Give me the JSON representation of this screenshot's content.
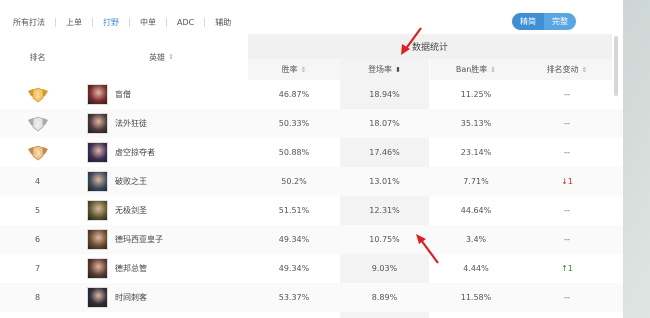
{
  "tabs": [
    {
      "label": "所有打法",
      "active": false
    },
    {
      "label": "上单",
      "active": false
    },
    {
      "label": "打野",
      "active": true
    },
    {
      "label": "中单",
      "active": false
    },
    {
      "label": "ADC",
      "active": false
    },
    {
      "label": "辅助",
      "active": false
    }
  ],
  "toggle": {
    "option_a": "精简",
    "option_b": "完整"
  },
  "headers": {
    "rank": "排名",
    "hero": "英雄",
    "group": "数据统计",
    "winrate": "胜率",
    "pickrate": "登场率",
    "banwinrate": "Ban胜率",
    "rank_change": "排名变动",
    "sort_icon": "⇕",
    "sort_active_icon": "⬍"
  },
  "rows": [
    {
      "rank": "1",
      "badge": "gold",
      "hero": "盲僧",
      "winrate": "46.87%",
      "pickrate": "18.94%",
      "banwinrate": "11.25%",
      "change": "--",
      "change_dir": "none"
    },
    {
      "rank": "2",
      "badge": "silver",
      "hero": "法外狂徒",
      "winrate": "50.33%",
      "pickrate": "18.07%",
      "banwinrate": "35.13%",
      "change": "--",
      "change_dir": "none"
    },
    {
      "rank": "3",
      "badge": "bronze",
      "hero": "虚空掠夺者",
      "winrate": "50.88%",
      "pickrate": "17.46%",
      "banwinrate": "23.14%",
      "change": "--",
      "change_dir": "none"
    },
    {
      "rank": "4",
      "badge": "",
      "hero": "破败之王",
      "winrate": "50.2%",
      "pickrate": "13.01%",
      "banwinrate": "7.71%",
      "change": "1",
      "change_dir": "down"
    },
    {
      "rank": "5",
      "badge": "",
      "hero": "无极剑圣",
      "winrate": "51.51%",
      "pickrate": "12.31%",
      "banwinrate": "44.64%",
      "change": "--",
      "change_dir": "none"
    },
    {
      "rank": "6",
      "badge": "",
      "hero": "德玛西亚皇子",
      "winrate": "49.34%",
      "pickrate": "10.75%",
      "banwinrate": "3.4%",
      "change": "--",
      "change_dir": "none"
    },
    {
      "rank": "7",
      "badge": "",
      "hero": "德邦总管",
      "winrate": "49.34%",
      "pickrate": "9.03%",
      "banwinrate": "4.44%",
      "change": "1",
      "change_dir": "up"
    },
    {
      "rank": "8",
      "badge": "",
      "hero": "时间刺客",
      "winrate": "53.37%",
      "pickrate": "8.89%",
      "banwinrate": "11.58%",
      "change": "--",
      "change_dir": "none"
    }
  ],
  "colors": {
    "accent": "#3f8fd2",
    "annotation": "#e02020",
    "down": "#d9232b",
    "up": "#2a8a3a"
  }
}
